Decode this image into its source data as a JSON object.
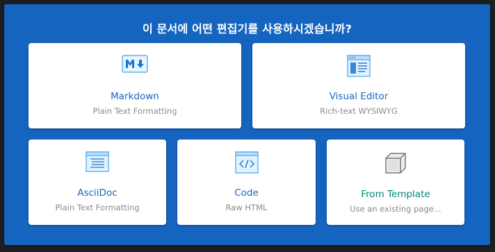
{
  "dialog": {
    "title": "이 문서에 어떤 편집기를 사용하시겠습니까?"
  },
  "editors": {
    "markdown": {
      "label": "Markdown",
      "description": "Plain Text Formatting",
      "icon": "markdown-icon"
    },
    "visual": {
      "label": "Visual Editor",
      "description": "Rich-text WYSIWYG",
      "icon": "visual-editor-icon"
    },
    "asciidoc": {
      "label": "AsciiDoc",
      "description": "Plain Text Formatting",
      "icon": "asciidoc-icon"
    },
    "code": {
      "label": "Code",
      "description": "Raw HTML",
      "icon": "code-icon"
    },
    "template": {
      "label": "From Template",
      "description": "Use an existing page...",
      "icon": "template-cube-icon"
    }
  },
  "colors": {
    "dialog_background": "#1565c0",
    "label_blue": "#1565c0",
    "label_teal": "#00897b",
    "description_gray": "#8a8a8a"
  }
}
